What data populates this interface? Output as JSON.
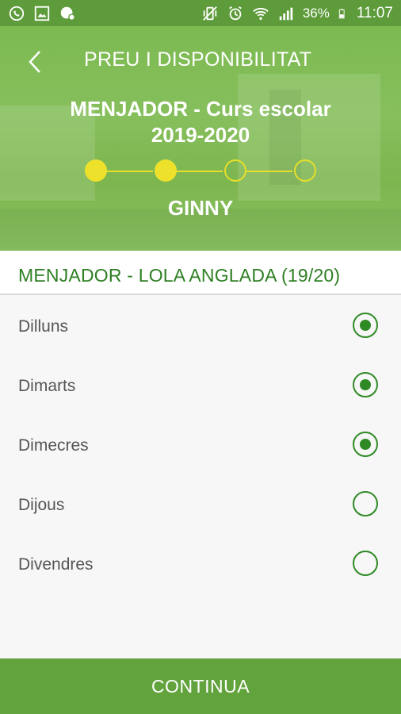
{
  "status_bar": {
    "battery": "36%",
    "time": "11:07",
    "icons": [
      "whatsapp-icon",
      "gallery-icon",
      "messenger-icon",
      "vibrate-icon",
      "alarm-icon",
      "wifi-icon",
      "signal-icon",
      "battery-icon"
    ]
  },
  "header": {
    "title": "PREU I DISPONIBILITAT",
    "course_line1": "MENJADOR - Curs escolar",
    "course_line2": "2019-2020",
    "student_name": "GINNY",
    "steps": [
      {
        "state": "done"
      },
      {
        "state": "done"
      },
      {
        "state": "todo"
      },
      {
        "state": "todo"
      }
    ]
  },
  "section": {
    "title": "MENJADOR - LOLA ANGLADA (19/20)"
  },
  "days": [
    {
      "label": "Dilluns",
      "selected": true
    },
    {
      "label": "Dimarts",
      "selected": true
    },
    {
      "label": "Dimecres",
      "selected": true
    },
    {
      "label": "Dijous",
      "selected": false
    },
    {
      "label": "Divendres",
      "selected": false
    }
  ],
  "cta": {
    "label": "CONTINUA"
  },
  "colors": {
    "primary": "#62a33d",
    "accent_yellow": "#eee12b",
    "section_green": "#2d7f22"
  }
}
